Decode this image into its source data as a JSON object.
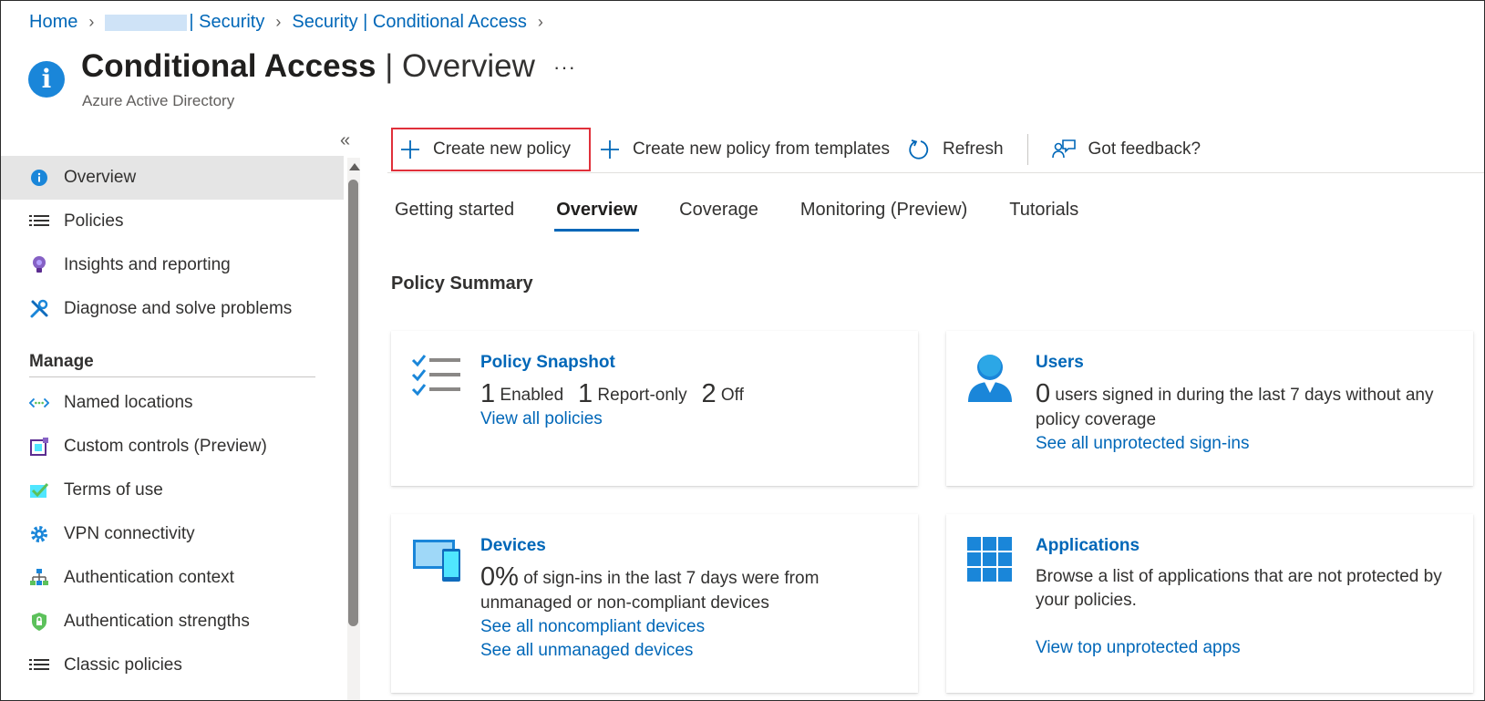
{
  "breadcrumb": {
    "home": "Home",
    "security": "| Security",
    "conditional_access": "Security | Conditional Access"
  },
  "header": {
    "title_bold": "Conditional Access",
    "title_rest": " | Overview",
    "more": "···",
    "subtitle": "Azure Active Directory"
  },
  "sidebar": {
    "collapse": "«",
    "items": [
      {
        "label": "Overview",
        "icon": "info-icon"
      },
      {
        "label": "Policies",
        "icon": "list-icon"
      },
      {
        "label": "Insights and reporting",
        "icon": "lightbulb-icon"
      },
      {
        "label": "Diagnose and solve problems",
        "icon": "wrench-icon"
      }
    ],
    "manage_heading": "Manage",
    "manage_items": [
      {
        "label": "Named locations",
        "icon": "named-locations-icon"
      },
      {
        "label": "Custom controls (Preview)",
        "icon": "custom-controls-icon"
      },
      {
        "label": "Terms of use",
        "icon": "terms-icon"
      },
      {
        "label": "VPN connectivity",
        "icon": "gear-icon"
      },
      {
        "label": "Authentication context",
        "icon": "hierarchy-icon"
      },
      {
        "label": "Authentication strengths",
        "icon": "shield-icon"
      },
      {
        "label": "Classic policies",
        "icon": "list-icon"
      }
    ]
  },
  "toolbar": {
    "create_policy": "Create new policy",
    "create_from_templates": "Create new policy from templates",
    "refresh": "Refresh",
    "feedback": "Got feedback?"
  },
  "tabs": [
    "Getting started",
    "Overview",
    "Coverage",
    "Monitoring (Preview)",
    "Tutorials"
  ],
  "active_tab": "Overview",
  "policy_summary": {
    "title": "Policy Summary",
    "snapshot": {
      "title": "Policy Snapshot",
      "enabled_count": "1",
      "enabled_label": "Enabled",
      "report_only_count": "1",
      "report_only_label": "Report-only",
      "off_count": "2",
      "off_label": "Off",
      "link": "View all policies"
    },
    "users": {
      "title": "Users",
      "count": "0",
      "text": "users signed in during the last 7 days without any policy coverage",
      "link": "See all unprotected sign-ins"
    },
    "devices": {
      "title": "Devices",
      "percent": "0%",
      "text": "of sign-ins in the last 7 days were from unmanaged or non-compliant devices",
      "link1": "See all noncompliant devices",
      "link2": "See all unmanaged devices"
    },
    "applications": {
      "title": "Applications",
      "text": "Browse a list of applications that are not protected by your policies.",
      "link": "View top unprotected apps"
    }
  },
  "colors": {
    "link": "#0067b8",
    "highlight_border": "#e0303a",
    "active_nav_bg": "#e5e5e5"
  }
}
